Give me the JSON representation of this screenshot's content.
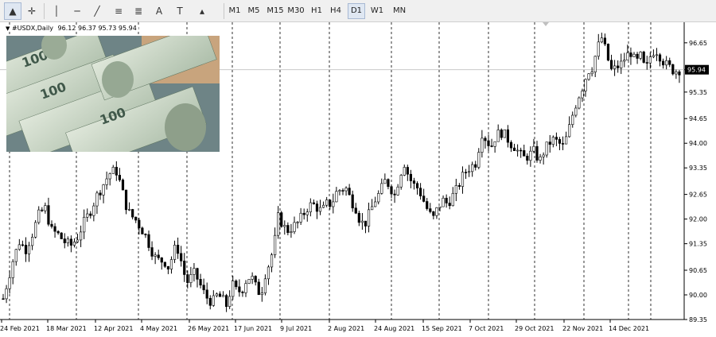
{
  "toolbar": {
    "tools": [
      {
        "name": "cursor-icon",
        "glyph": "▲",
        "active": true
      },
      {
        "name": "crosshair-icon",
        "glyph": "✛"
      },
      {
        "name": "vertical-line-icon",
        "glyph": "│"
      },
      {
        "name": "horizontal-line-icon",
        "glyph": "─"
      },
      {
        "name": "trendline-icon",
        "glyph": "╱"
      },
      {
        "name": "channel-icon",
        "glyph": "≡"
      },
      {
        "name": "fibonacci-icon",
        "glyph": "≣"
      },
      {
        "name": "text-icon",
        "glyph": "A"
      },
      {
        "name": "text-label-icon",
        "glyph": "T"
      },
      {
        "name": "shapes-icon",
        "glyph": "▴"
      }
    ],
    "timeframes": [
      "M1",
      "M5",
      "M15",
      "M30",
      "H1",
      "H4",
      "D1",
      "W1",
      "MN"
    ],
    "active_timeframe": "D1"
  },
  "chart_header": {
    "symbol": "#USDX,Daily",
    "ohlc": "96.12 96.37 95.73 95.94"
  },
  "chart_data": {
    "type": "candlestick",
    "symbol": "#USDX",
    "timeframe": "Daily",
    "last_price": "95.94",
    "price_axis": {
      "ticks": [
        "96.65",
        "95.94",
        "95.35",
        "94.65",
        "94.00",
        "93.35",
        "92.65",
        "92.00",
        "91.35",
        "90.65",
        "90.00",
        "89.35"
      ],
      "range": [
        89.35,
        97.15
      ]
    },
    "date_labels": [
      "24 Feb 2021",
      "18 Mar 2021",
      "12 Apr 2021",
      "4 May 2021",
      "26 May 2021",
      "17 Jun 2021",
      "9 Jul 2021",
      "2 Aug 2021",
      "24 Aug 2021",
      "15 Sep 2021",
      "7 Oct 2021",
      "29 Oct 2021",
      "22 Nov 2021",
      "14 Dec 2021"
    ],
    "grid": "vertical dashed separators",
    "close_path": [
      [
        0,
        89.9
      ],
      [
        3,
        90.4
      ],
      [
        6,
        90.9
      ],
      [
        10,
        91.4
      ],
      [
        14,
        91.2
      ],
      [
        18,
        91.6
      ],
      [
        22,
        92.1
      ],
      [
        26,
        92.3
      ],
      [
        30,
        91.7
      ],
      [
        34,
        91.6
      ],
      [
        38,
        91.4
      ],
      [
        42,
        91.3
      ],
      [
        46,
        91.5
      ],
      [
        50,
        91.9
      ],
      [
        54,
        92.2
      ],
      [
        58,
        92.6
      ],
      [
        62,
        92.9
      ],
      [
        66,
        93.2
      ],
      [
        70,
        93.3
      ],
      [
        73,
        92.9
      ],
      [
        76,
        92.4
      ],
      [
        79,
        92.1
      ],
      [
        82,
        92.0
      ],
      [
        85,
        91.8
      ],
      [
        88,
        91.6
      ],
      [
        91,
        91.3
      ],
      [
        94,
        91.0
      ],
      [
        97,
        90.9
      ],
      [
        100,
        90.9
      ],
      [
        103,
        90.7
      ],
      [
        106,
        91.2
      ],
      [
        109,
        91.2
      ],
      [
        112,
        90.6
      ],
      [
        115,
        90.3
      ],
      [
        118,
        90.6
      ],
      [
        121,
        90.4
      ],
      [
        124,
        90.1
      ],
      [
        127,
        89.9
      ],
      [
        130,
        89.8
      ],
      [
        133,
        90.0
      ],
      [
        136,
        89.9
      ],
      [
        139,
        89.7
      ],
      [
        142,
        90.3
      ],
      [
        145,
        90.1
      ],
      [
        148,
        90.1
      ],
      [
        151,
        90.4
      ],
      [
        154,
        90.5
      ],
      [
        157,
        90.2
      ],
      [
        160,
        90.0
      ],
      [
        163,
        90.6
      ],
      [
        166,
        90.9
      ],
      [
        169,
        91.5
      ],
      [
        171,
        92.1
      ],
      [
        174,
        91.8
      ],
      [
        177,
        91.7
      ],
      [
        180,
        91.8
      ],
      [
        183,
        91.9
      ],
      [
        186,
        92.1
      ],
      [
        189,
        92.3
      ],
      [
        192,
        92.4
      ],
      [
        195,
        92.3
      ],
      [
        198,
        92.2
      ],
      [
        201,
        92.4
      ],
      [
        204,
        92.4
      ],
      [
        207,
        92.7
      ],
      [
        210,
        92.8
      ],
      [
        213,
        92.8
      ],
      [
        216,
        92.5
      ],
      [
        219,
        92.3
      ],
      [
        222,
        91.9
      ],
      [
        225,
        91.9
      ],
      [
        228,
        92.2
      ],
      [
        231,
        92.5
      ],
      [
        234,
        92.7
      ],
      [
        237,
        93.0
      ],
      [
        240,
        92.9
      ],
      [
        243,
        92.6
      ],
      [
        246,
        93.1
      ],
      [
        249,
        93.5
      ],
      [
        252,
        93.1
      ],
      [
        255,
        92.9
      ],
      [
        258,
        92.8
      ],
      [
        261,
        92.5
      ],
      [
        264,
        92.2
      ],
      [
        267,
        92.0
      ],
      [
        270,
        92.3
      ],
      [
        273,
        92.5
      ],
      [
        276,
        92.4
      ],
      [
        279,
        92.6
      ],
      [
        282,
        92.8
      ],
      [
        285,
        93.1
      ],
      [
        288,
        93.3
      ],
      [
        291,
        93.4
      ],
      [
        294,
        93.5
      ],
      [
        297,
        94.3
      ],
      [
        300,
        94.1
      ],
      [
        303,
        93.9
      ],
      [
        306,
        94.2
      ],
      [
        309,
        94.3
      ],
      [
        312,
        94.2
      ],
      [
        315,
        94.0
      ],
      [
        318,
        93.9
      ],
      [
        321,
        93.7
      ],
      [
        324,
        93.6
      ],
      [
        327,
        93.7
      ],
      [
        330,
        93.8
      ],
      [
        333,
        93.5
      ],
      [
        336,
        93.8
      ],
      [
        339,
        94.0
      ],
      [
        342,
        94.1
      ],
      [
        345,
        94.0
      ],
      [
        348,
        93.9
      ],
      [
        351,
        94.3
      ],
      [
        354,
        94.8
      ],
      [
        357,
        95.2
      ],
      [
        360,
        95.5
      ],
      [
        363,
        95.9
      ],
      [
        366,
        96.0
      ],
      [
        369,
        96.5
      ],
      [
        372,
        96.8
      ],
      [
        375,
        96.3
      ],
      [
        378,
        95.9
      ],
      [
        381,
        96.0
      ],
      [
        384,
        96.1
      ],
      [
        387,
        96.3
      ],
      [
        390,
        96.4
      ],
      [
        393,
        96.1
      ],
      [
        396,
        96.3
      ],
      [
        399,
        95.9
      ],
      [
        402,
        96.3
      ],
      [
        405,
        96.5
      ],
      [
        408,
        96.3
      ],
      [
        411,
        96.1
      ],
      [
        414,
        96.0
      ],
      [
        417,
        95.9
      ],
      [
        420,
        95.94
      ]
    ]
  }
}
